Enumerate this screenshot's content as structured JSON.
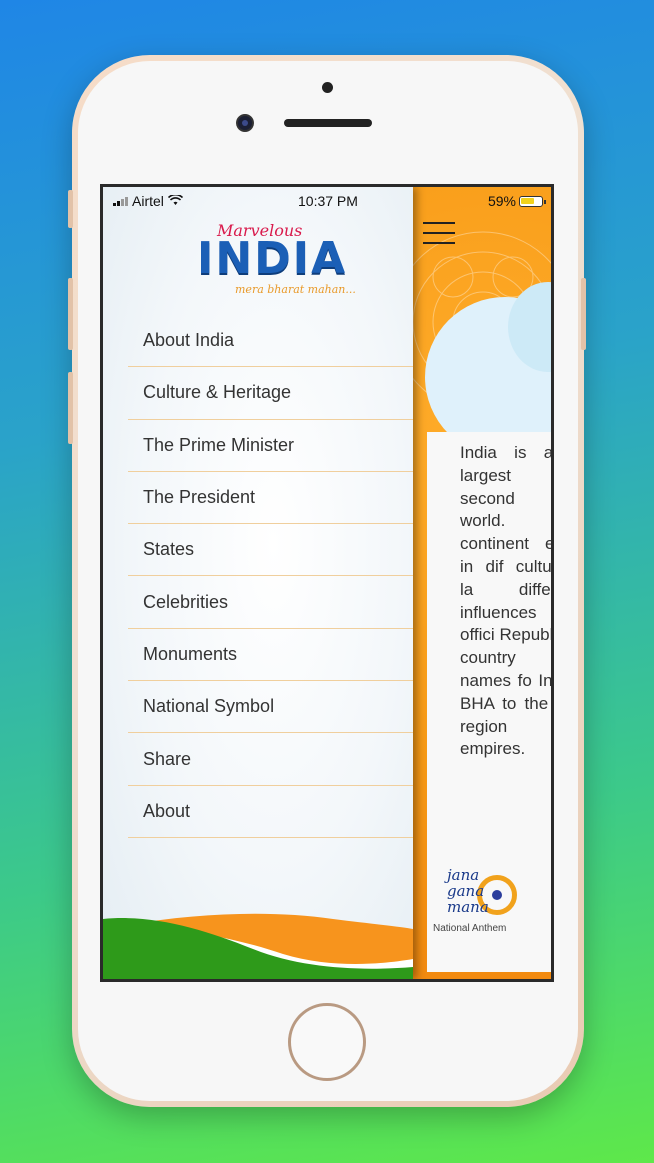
{
  "status_bar": {
    "carrier": "Airtel",
    "time": "10:37 PM",
    "battery": "59%"
  },
  "logo": {
    "top_text": "Marvelous",
    "main_text": "INDIA",
    "tagline": "mera bharat mahan..."
  },
  "nav": {
    "items": [
      {
        "label": "About India"
      },
      {
        "label": "Culture & Heritage"
      },
      {
        "label": "The Prime Minister"
      },
      {
        "label": "The President"
      },
      {
        "label": "States"
      },
      {
        "label": "Celebrities"
      },
      {
        "label": "Monuments"
      },
      {
        "label": "National Symbol"
      },
      {
        "label": "Share"
      },
      {
        "label": "About"
      }
    ]
  },
  "content": {
    "body_text": "India is a g largest co second m world. M continent exist in dif cultures, la different influences The offici Republic o country IN names fo India; BHA to the Ind region of empires."
  },
  "anthem": {
    "words": [
      "jana",
      "gana",
      "mana"
    ],
    "caption": "National Anthem"
  },
  "colors": {
    "brand_blue": "#1b5fb6",
    "saffron": "#f79a16",
    "green": "#2e9a1a",
    "divider": "#f0cf9d"
  }
}
